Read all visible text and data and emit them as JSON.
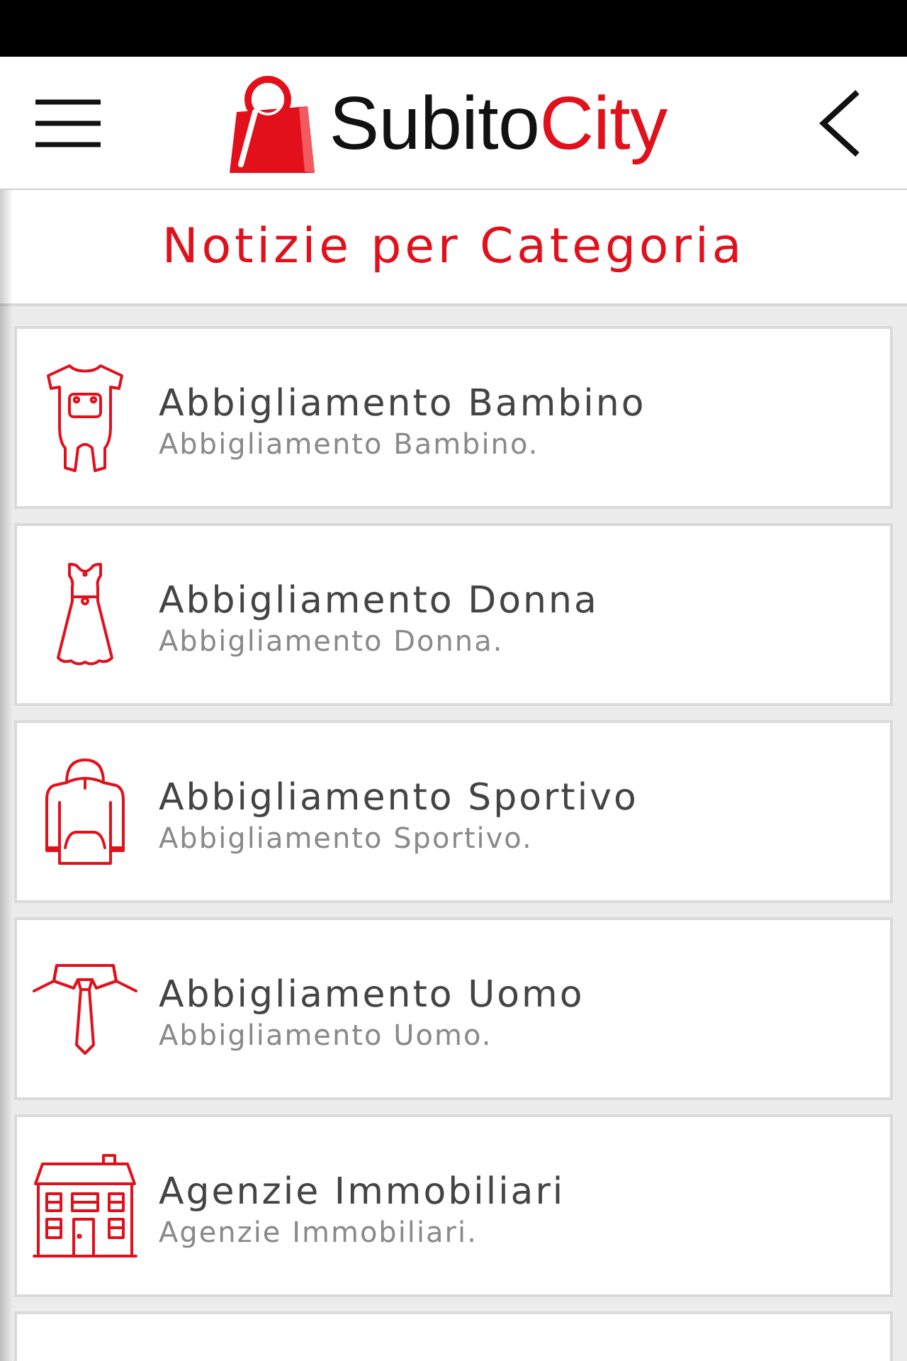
{
  "header": {
    "logo": {
      "text": "Subito",
      "accent": "City"
    }
  },
  "page_title": "Notizie per Categoria",
  "categories": [
    {
      "title": "Abbigliamento Bambino",
      "subtitle": "Abbigliamento Bambino."
    },
    {
      "title": "Abbigliamento Donna",
      "subtitle": "Abbigliamento Donna."
    },
    {
      "title": "Abbigliamento Sportivo",
      "subtitle": "Abbigliamento Sportivo."
    },
    {
      "title": "Abbigliamento Uomo",
      "subtitle": "Abbigliamento Uomo."
    },
    {
      "title": "Agenzie Immobiliari",
      "subtitle": "Agenzie Immobiliari."
    }
  ]
}
